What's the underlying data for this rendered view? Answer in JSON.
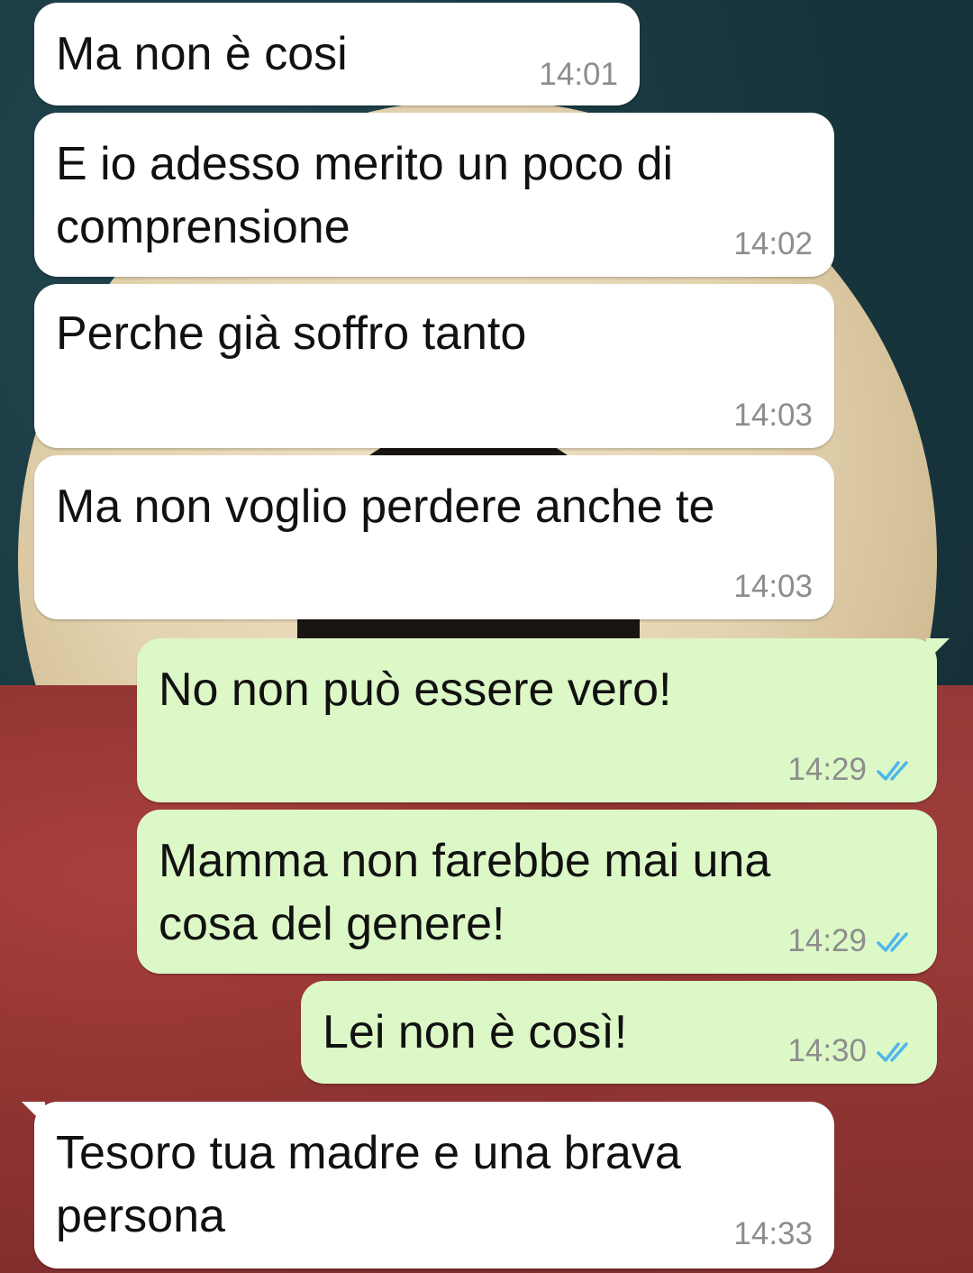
{
  "messages": [
    {
      "direction": "incoming",
      "text": "Ma non è cosi",
      "time": "14:01"
    },
    {
      "direction": "incoming",
      "text": "E io adesso merito un poco di\ncomprensione",
      "time": "14:02"
    },
    {
      "direction": "incoming",
      "text": "Perche già soffro tanto",
      "time": "14:03"
    },
    {
      "direction": "incoming",
      "text": "Ma non voglio perdere anche te",
      "time": "14:03"
    },
    {
      "direction": "outgoing",
      "text": "No non può essere vero!",
      "time": "14:29",
      "status_icon": "double-check-read-icon"
    },
    {
      "direction": "outgoing",
      "text": "Mamma non farebbe mai una\ncosa del genere!",
      "time": "14:29",
      "status_icon": "double-check-read-icon"
    },
    {
      "direction": "outgoing",
      "text": "Lei non è così!",
      "time": "14:30",
      "status_icon": "double-check-read-icon"
    },
    {
      "direction": "incoming",
      "text": "Tesoro tua madre e una brava\npersona",
      "time": "14:33"
    }
  ],
  "colors": {
    "incoming_bubble": "#ffffff",
    "outgoing_bubble": "#dcf8c6",
    "read_tick": "#4fb6ec",
    "timestamp": "#8d8d8d"
  }
}
